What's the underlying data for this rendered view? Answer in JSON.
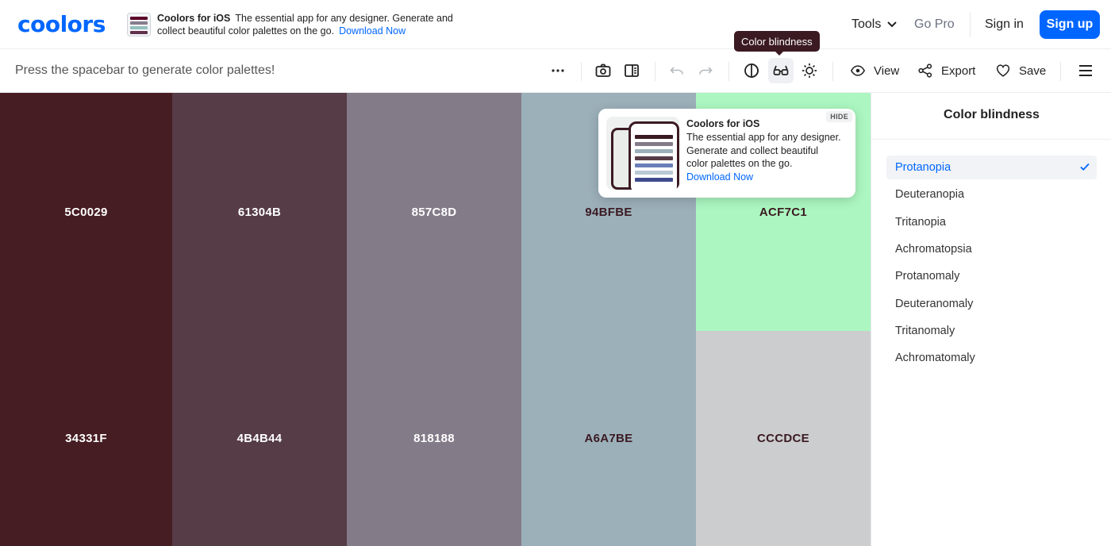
{
  "brand": {
    "logo": "coolors"
  },
  "promo_banner": {
    "title": "Coolors for iOS",
    "text": "The essential app for any designer. Generate and collect beautiful color palettes on the go.",
    "link": "Download Now"
  },
  "nav": {
    "tools": "Tools",
    "go_pro": "Go Pro",
    "sign_in": "Sign in",
    "sign_up": "Sign up"
  },
  "toolbar": {
    "hint": "Press the spacebar to generate color palettes!",
    "view_label": "View",
    "export_label": "Export",
    "save_label": "Save",
    "tooltip": "Color blindness"
  },
  "palette": {
    "top": [
      {
        "hex": "5C0029",
        "color": "#461d23",
        "text": "light"
      },
      {
        "hex": "61304B",
        "color": "#563c47",
        "text": "light"
      },
      {
        "hex": "857C8D",
        "color": "#847b89",
        "text": "light"
      },
      {
        "hex": "94BFBE",
        "color": "#9cb0ba",
        "text": "dark"
      },
      {
        "hex": "ACF7C1",
        "color": "#acf7c1",
        "text": "dark"
      }
    ],
    "bottom": [
      {
        "hex": "34331F",
        "color": "#461d23",
        "text": "light"
      },
      {
        "hex": "4B4B44",
        "color": "#563c47",
        "text": "light"
      },
      {
        "hex": "818188",
        "color": "#847b89",
        "text": "light"
      },
      {
        "hex": "A6A7BE",
        "color": "#9cb0ba",
        "text": "dark"
      },
      {
        "hex": "CCCDCE",
        "color": "#cccdce",
        "text": "dark"
      }
    ]
  },
  "popup": {
    "hide": "HIDE",
    "title": "Coolors for iOS",
    "line1": "The essential app for any designer.",
    "line2": "Generate and collect beautiful",
    "line3": "color palettes on the go.",
    "link": "Download Now"
  },
  "color_blindness_panel": {
    "title": "Color blindness",
    "options": [
      {
        "label": "Protanopia",
        "selected": true
      },
      {
        "label": "Deuteranopia",
        "selected": false
      },
      {
        "label": "Tritanopia",
        "selected": false
      },
      {
        "label": "Achromatopsia",
        "selected": false
      },
      {
        "label": "Protanomaly",
        "selected": false
      },
      {
        "label": "Deuteranomaly",
        "selected": false
      },
      {
        "label": "Tritanomaly",
        "selected": false
      },
      {
        "label": "Achromatomaly",
        "selected": false
      }
    ]
  },
  "colors": {
    "accent": "#0066ff",
    "tooltip_bg": "#3b1a22"
  },
  "icons": [
    "more-icon",
    "camera-icon",
    "panel-icon",
    "undo-icon",
    "redo-icon",
    "contrast-icon",
    "glasses-icon",
    "brightness-icon",
    "eye-icon",
    "share-icon",
    "heart-icon",
    "menu-icon",
    "chevron-down-icon",
    "check-icon"
  ]
}
